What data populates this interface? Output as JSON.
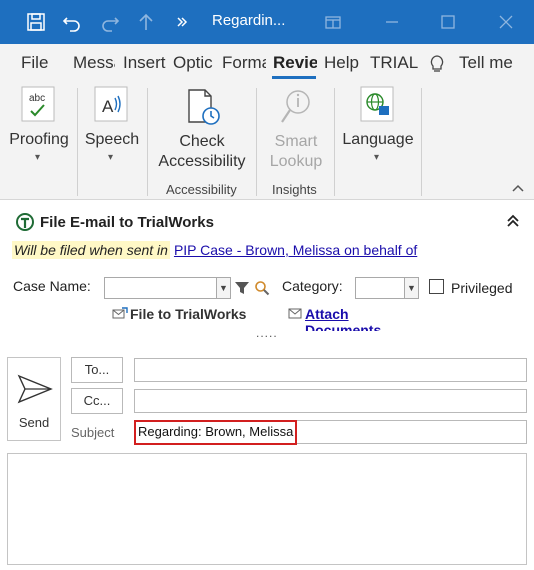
{
  "titlebar": {
    "title": "Regardin...",
    "icons": [
      "save-icon",
      "undo-icon",
      "redo-icon",
      "up-arrow-icon",
      "more-icon",
      "restore-window-icon",
      "minimize-icon",
      "maximize-icon",
      "close-icon"
    ],
    "accent": "#1e6fbf"
  },
  "tabs": [
    {
      "label": "File"
    },
    {
      "label": "Messa"
    },
    {
      "label": "Insert"
    },
    {
      "label": "Optic"
    },
    {
      "label": "Forma"
    },
    {
      "label": "Revie",
      "active": true
    },
    {
      "label": "Help"
    },
    {
      "label": "TRIAL"
    },
    {
      "label": "Tell me"
    }
  ],
  "ribbon": {
    "proofing": {
      "label": "Proofing",
      "icon_text": "abc"
    },
    "speech": {
      "label": "Speech"
    },
    "check_accessibility": {
      "line1": "Check",
      "line2": "Accessibility"
    },
    "smart_lookup": {
      "line1": "Smart",
      "line2": "Lookup",
      "disabled": true
    },
    "language": {
      "label": "Language"
    },
    "groups": {
      "accessibility": "Accessibility",
      "insights": "Insights"
    }
  },
  "trialworks": {
    "title": "File E-mail to TrialWorks",
    "filed_prefix": "Will be filed when sent in",
    "filed_link": "PIP Case - Brown, Melissa on behalf of",
    "case_name_label": "Case Name:",
    "category_label": "Category:",
    "privileged_label": "Privileged",
    "file_button": "File to TrialWorks",
    "attach_line1": "Attach",
    "attach_line2": "Documents",
    "dots": "....."
  },
  "compose": {
    "send_label": "Send",
    "to_label": "To...",
    "cc_label": "Cc...",
    "subject_label": "Subject",
    "subject_value": "Regarding: Brown, Melissa",
    "highlight_color": "#d21f1f"
  }
}
